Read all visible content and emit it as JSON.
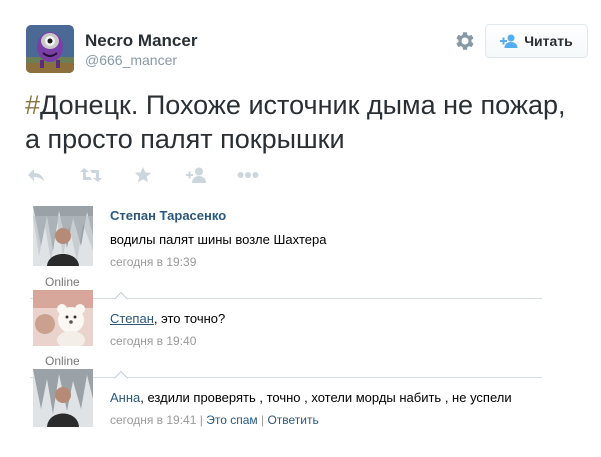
{
  "tweet": {
    "author_name": "Necro Mancer",
    "author_handle": "@666_mancer",
    "follow_label": "Читать",
    "text_hash": "#",
    "text_body": "Донецк. Похоже источник дыма не пожар, а просто палят покрышки",
    "actions": [
      "reply-icon",
      "retweet-icon",
      "favorite-icon",
      "follow-icon",
      "more-icon"
    ]
  },
  "comments": [
    {
      "author": "Степан Тарасенко",
      "text": "водилы палят шины возле Шахтера",
      "time": "сегодня в 19:39",
      "status": "Online"
    },
    {
      "mention": "Степан",
      "text": ", это точно?",
      "time": "сегодня в 19:40",
      "status": "Online"
    },
    {
      "mention": "Анна",
      "text": ", ездили проверять , точно , хотели морды набить , не успели",
      "time": "сегодня в 19:41",
      "spam_label": "Это спам",
      "reply_label": "Ответить",
      "divider": "|"
    }
  ],
  "colors": {
    "hashtag": "#8a7340",
    "vk_link": "#2b587a",
    "twitter_blue": "#55acee",
    "icon_grey": "#ccd6dd"
  }
}
